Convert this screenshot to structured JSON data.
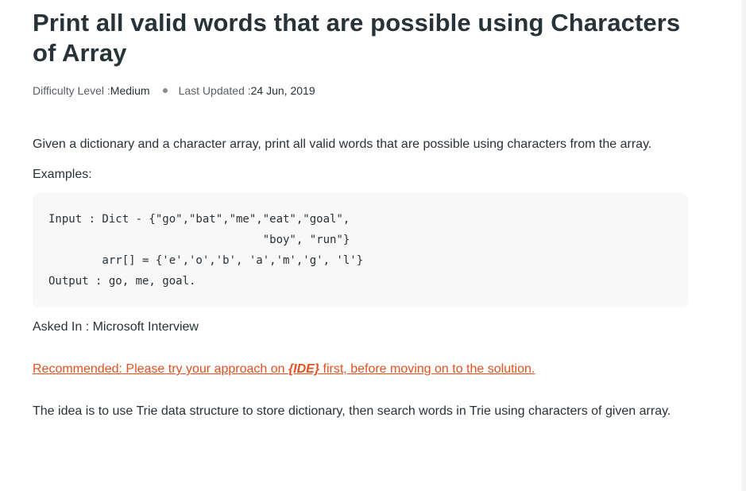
{
  "article": {
    "title": "Print all valid words that are possible using Characters of Array",
    "meta": {
      "difficulty_label": "Difficulty Level : ",
      "difficulty_value": "Medium",
      "updated_label": "Last Updated : ",
      "updated_value": "24 Jun, 2019"
    },
    "intro": "Given a dictionary and a character array, print all valid words that are possible using characters from the array.",
    "examples_label": "Examples:",
    "code_example": "Input : Dict - {\"go\",\"bat\",\"me\",\"eat\",\"goal\",\n                                \"boy\", \"run\"}\n        arr[] = {'e','o','b', 'a','m','g', 'l'}\nOutput : go, me, goal.",
    "asked_in": "Asked In : Microsoft Interview",
    "recommended": {
      "before": "Recommended: Please try your approach on ",
      "ide": "{IDE}",
      "after": " first, before moving on to the solution."
    },
    "idea": "The idea is to use Trie data structure to store dictionary, then search words in Trie using characters of given array."
  },
  "colors": {
    "text": "#273239",
    "muted": "#5b6066",
    "link": "#e5501e",
    "code_bg": "#f8f8f8"
  }
}
